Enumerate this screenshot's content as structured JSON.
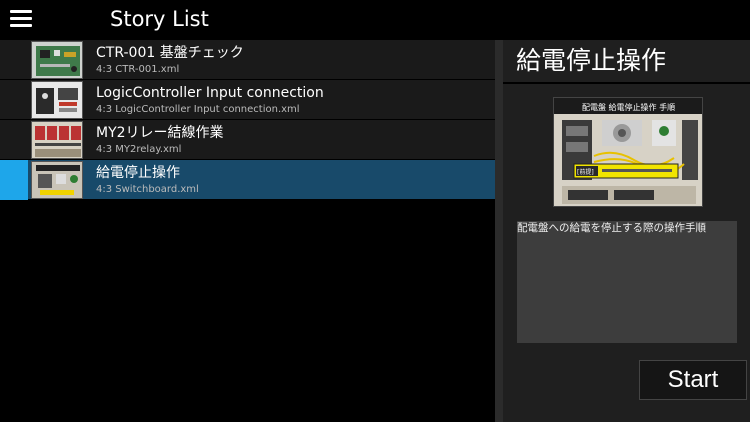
{
  "header": {
    "title": "Story List",
    "menu_icon": "hamburger-menu-icon"
  },
  "stories": [
    {
      "name": "CTR-001 基盤チェック",
      "file": "4:3 CTR-001.xml",
      "selected": false
    },
    {
      "name": "LogicController Input connection",
      "file": "4:3 LogicController Input connection.xml",
      "selected": false
    },
    {
      "name": "MY2リレー結線作業",
      "file": "4:3 MY2relay.xml",
      "selected": false
    },
    {
      "name": "給電停止操作",
      "file": "4:3 Switchboard.xml",
      "selected": true
    }
  ],
  "detail": {
    "title": "給電停止操作",
    "preview_caption": "配電盤 給電停止操作 手順",
    "preview_badge": "[前提]",
    "description": "配電盤への給電を停止する際の操作手順",
    "start_label": "Start"
  },
  "colors": {
    "selected_row": "#184a6a",
    "selected_indicator": "#1ea6ea",
    "row_background": "#1a1a1a",
    "panel_background": "#1f1f1f"
  }
}
